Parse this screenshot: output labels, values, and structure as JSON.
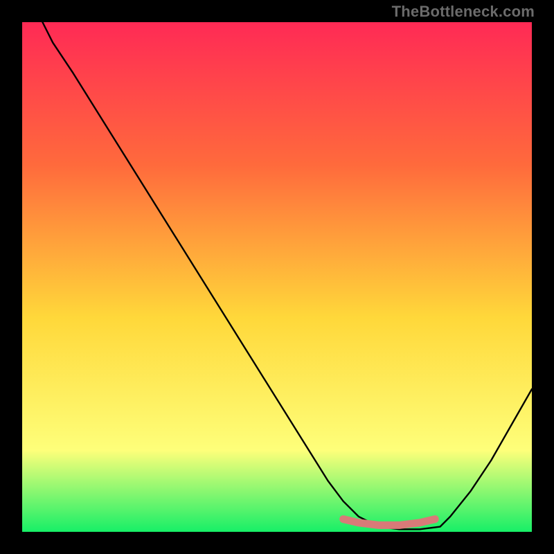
{
  "watermark": "TheBottleneck.com",
  "chart_data": {
    "type": "line",
    "title": "",
    "xlabel": "",
    "ylabel": "",
    "xlim": [
      0,
      100
    ],
    "ylim": [
      0,
      100
    ],
    "background_gradient": {
      "top": "#ff2a55",
      "mid1": "#ff6a3c",
      "mid2": "#ffd83a",
      "mid3": "#feff7a",
      "bottom": "#17ef67"
    },
    "curve": {
      "name": "bottleneck-curve",
      "color": "#000000",
      "x": [
        4,
        6,
        10,
        15,
        20,
        25,
        30,
        35,
        40,
        45,
        50,
        55,
        60,
        63,
        66,
        70,
        74,
        78,
        82,
        84,
        88,
        92,
        96,
        100
      ],
      "y": [
        100,
        96,
        90,
        82,
        74,
        66,
        58,
        50,
        42,
        34,
        26,
        18,
        10,
        6,
        3,
        1,
        0.5,
        0.5,
        1,
        3,
        8,
        14,
        21,
        28
      ]
    },
    "highlight_band": {
      "name": "optimal-range",
      "color": "#d97a78",
      "x": [
        63,
        66,
        70,
        74,
        78,
        81
      ],
      "y": [
        2.5,
        1.8,
        1.3,
        1.3,
        1.8,
        2.5
      ]
    }
  }
}
